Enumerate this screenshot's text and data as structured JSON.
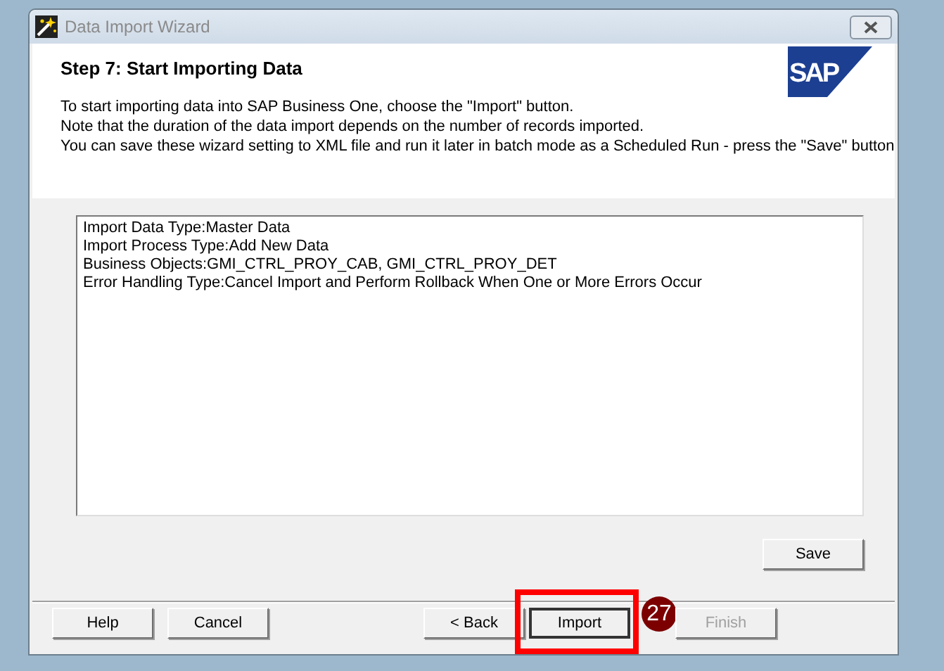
{
  "window": {
    "title": "Data Import Wizard",
    "active": false
  },
  "header": {
    "title": "Step 7: Start Importing Data",
    "lines": [
      "To start importing data into SAP Business One, choose the \"Import\" button.",
      "Note that the duration of the data import depends on the number of records imported.",
      "You can save these wizard setting to XML file and run it later in batch mode as a Scheduled Run - press the \"Save\" button"
    ],
    "logo": "SAP"
  },
  "summary": [
    "Import Data Type:Master Data",
    "Import Process Type:Add New Data",
    "Business Objects:GMI_CTRL_PROY_CAB, GMI_CTRL_PROY_DET",
    "Error Handling Type:Cancel Import and Perform Rollback When One or More Errors Occur"
  ],
  "save_button": {
    "label": "Save",
    "disabled": false
  },
  "left_buttons": [
    {
      "label": "Help",
      "disabled": false,
      "focused": false,
      "highlighted": false
    },
    {
      "label": "Cancel",
      "disabled": false,
      "focused": false,
      "highlighted": false
    }
  ],
  "buttons": [
    {
      "label": "< Back",
      "disabled": false,
      "focused": false,
      "highlighted": false
    },
    {
      "label": "Import",
      "disabled": false,
      "focused": true,
      "highlighted": true,
      "step": "27"
    },
    {
      "label": "Finish",
      "disabled": true,
      "focused": false,
      "highlighted": false
    }
  ]
}
